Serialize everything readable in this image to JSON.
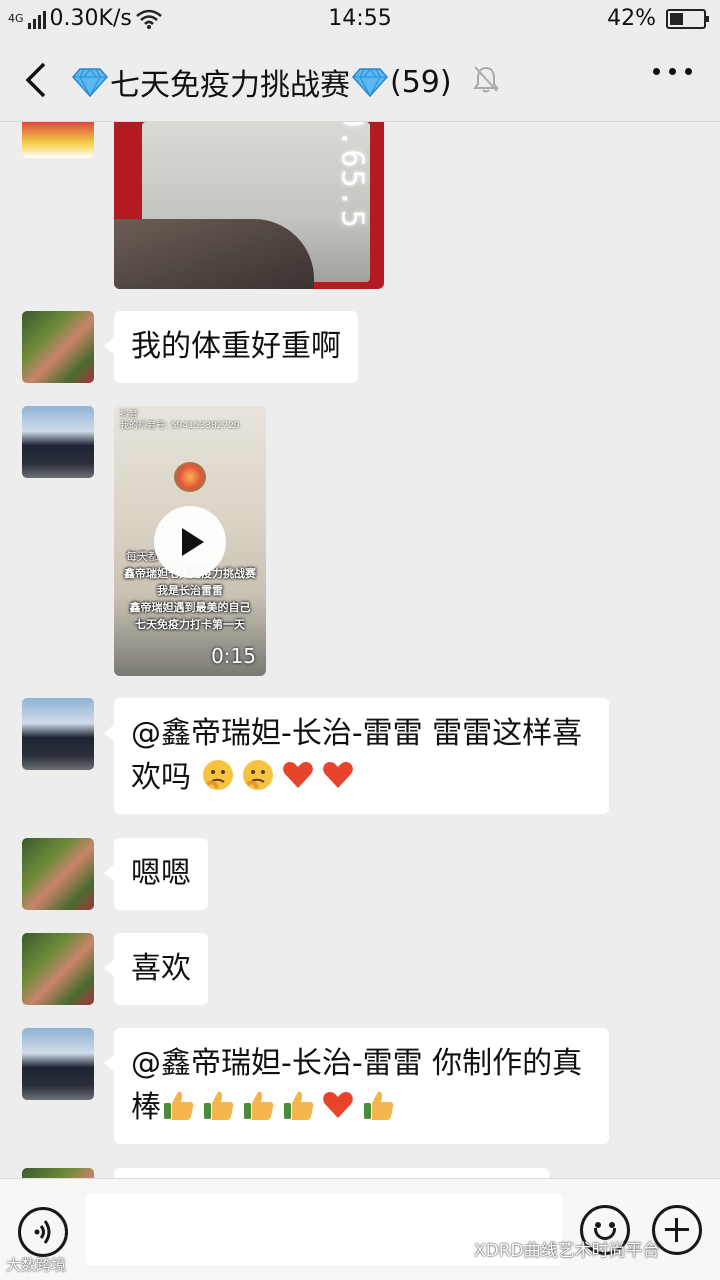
{
  "status_bar": {
    "network": "4G",
    "speed": "0.30K/s",
    "time": "14:55",
    "battery_percent": "42%",
    "battery_level": 0.42
  },
  "header": {
    "title": "七天免疫力挑战赛",
    "member_count": "(59)"
  },
  "messages": [
    {
      "type": "image",
      "avatar": "red-envelope-avatar",
      "scale_reading": "0.65.5"
    },
    {
      "type": "text",
      "avatar": "girl-avatar",
      "text": "我的体重好重啊"
    },
    {
      "type": "video",
      "avatar": "car-avatar",
      "app_label": "抖音",
      "app_id": "我的抖音号: 594153382729",
      "caption_lines": [
        "每天都",
        "鑫帝瑞妲七天免疫力挑战赛",
        "我是长治雷雷",
        "鑫帝瑞妲遇到最美的自己",
        "七天免疫力打卡第一天"
      ],
      "duration": "0:15"
    },
    {
      "type": "text",
      "avatar": "car-avatar",
      "line1": "@鑫帝瑞妲-长治-雷雷  雷雷这样喜",
      "line2": "欢吗"
    },
    {
      "type": "text",
      "avatar": "girl-avatar",
      "text": "嗯嗯"
    },
    {
      "type": "text",
      "avatar": "girl-avatar",
      "text": "喜欢"
    },
    {
      "type": "text",
      "avatar": "car-avatar",
      "line1": "@鑫帝瑞妲-长治-雷雷  你制作的真",
      "line2": "棒"
    }
  ],
  "watermarks": {
    "left": "大数跨境",
    "right": "XDRD曲线艺术时尚平台"
  },
  "colors": {
    "background": "#ededed",
    "bubble": "#ffffff",
    "heart": "#e8442c",
    "thumb": "#f5b54d"
  }
}
